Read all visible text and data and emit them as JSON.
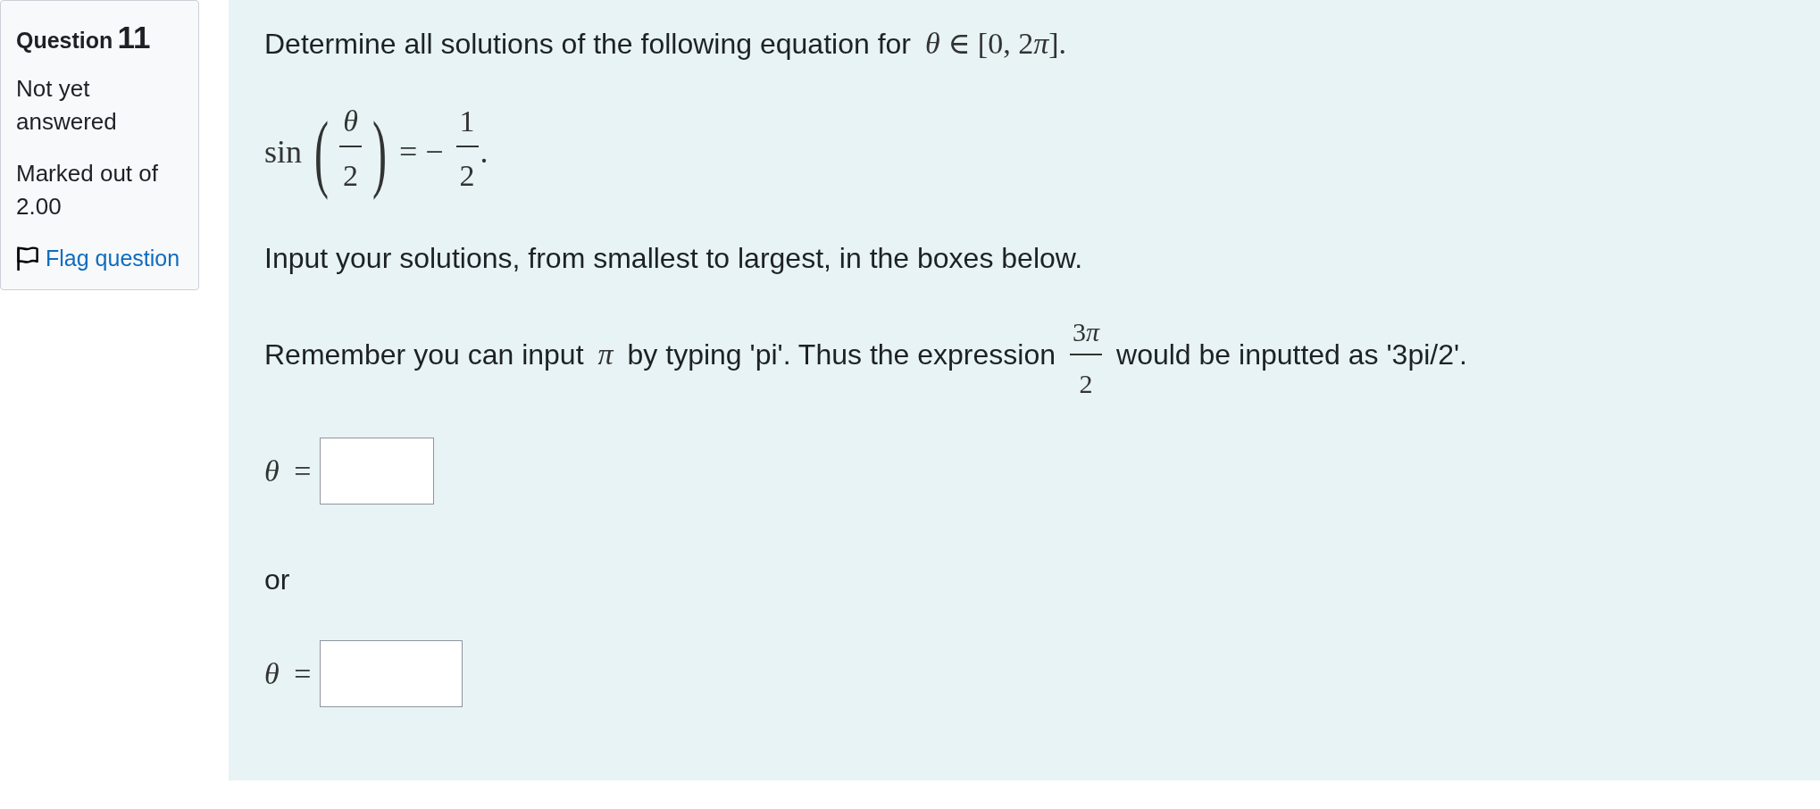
{
  "info": {
    "label": "Question",
    "number": "11",
    "state": "Not yet answered",
    "grade": "Marked out of 2.00",
    "flag": {
      "label": "Flag question",
      "flagged": false
    }
  },
  "question": {
    "blocks": [
      {
        "kind": "paragraph",
        "parts": [
          {
            "kind": "text",
            "text": "Determine all solutions of the following equation for"
          },
          {
            "kind": "math",
            "pieces": [
              "*θ* ∈ [0, 2",
              "*π*",
              "]."
            ]
          }
        ]
      },
      {
        "kind": "equation",
        "parts": [
          {
            "kind": "math",
            "pieces": [
              "sin"
            ]
          },
          {
            "kind": "paren-fraction",
            "open": "(",
            "numerator": [
              "*θ*"
            ],
            "denominator": [
              "2"
            ],
            "close": ")"
          },
          {
            "kind": "math",
            "pieces": [
              "= −"
            ]
          },
          {
            "kind": "fraction",
            "numerator": [
              "1"
            ],
            "denominator": [
              "2"
            ]
          },
          {
            "kind": "math",
            "pieces": [
              "."
            ]
          }
        ]
      },
      {
        "kind": "paragraph",
        "parts": [
          {
            "kind": "text",
            "text": "Input your solutions, from smallest to largest, in the boxes below."
          }
        ]
      },
      {
        "kind": "paragraph",
        "parts": [
          {
            "kind": "text",
            "text": "Remember you can input"
          },
          {
            "kind": "math",
            "pieces": [
              "*π*"
            ]
          },
          {
            "kind": "text",
            "text": "by typing 'pi'. Thus the expression"
          },
          {
            "kind": "fraction",
            "numerator": [
              "3",
              "*π*"
            ],
            "denominator": [
              "2"
            ]
          },
          {
            "kind": "text",
            "text": "would be inputted as '3pi/2'."
          }
        ]
      },
      {
        "kind": "answer",
        "label": [
          "*θ* ="
        ]
      },
      {
        "kind": "paragraph",
        "parts": [
          {
            "kind": "text",
            "text": "or"
          }
        ]
      },
      {
        "kind": "answer",
        "label": [
          "*θ* ="
        ]
      }
    ]
  }
}
